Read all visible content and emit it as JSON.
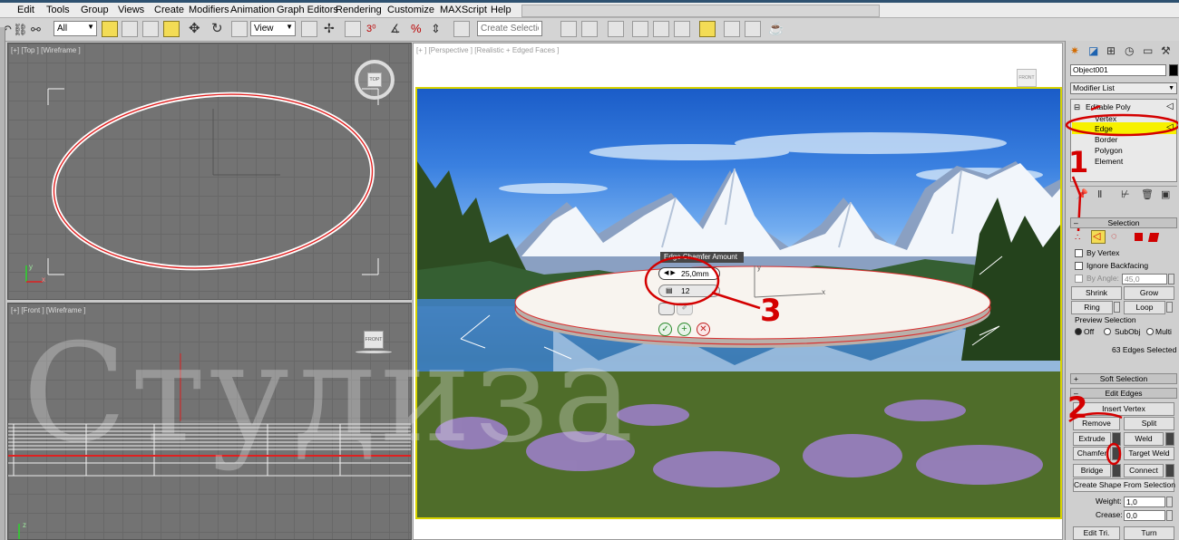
{
  "menu": [
    "Edit",
    "Tools",
    "Group",
    "Views",
    "Create",
    "Modifiers",
    "Animation",
    "Graph Editors",
    "Rendering",
    "Customize",
    "MAXScript",
    "Help"
  ],
  "toolbar": {
    "filter_value": "All",
    "refcoord_value": "View",
    "selection_set_placeholder": "Create Selection Se"
  },
  "viewports": {
    "top_label": "[+] [Top ] [Wireframe ]",
    "front_label": "[+] [Front ] [Wireframe ]",
    "persp_label": "[+ ] [Perspective ] [Realistic + Edged Faces ]",
    "viewcube_top": "TOP",
    "viewcube_front": "FRONT",
    "axis_x": "x",
    "axis_y": "y",
    "axis_z": "z"
  },
  "caddy": {
    "title": "Edge Chamfer Amount",
    "amount": "25,0mm",
    "segments": "12"
  },
  "watermark": "Студиза",
  "annotations": {
    "one": "1",
    "two": "2",
    "three": "3"
  },
  "command_panel": {
    "object_name": "Object001",
    "modifier_list": "Modifier List",
    "stack": {
      "base": "Editable Poly",
      "items": [
        "Vertex",
        "Edge",
        "Border",
        "Polygon",
        "Element"
      ],
      "selected_index": 1
    },
    "selection": {
      "title": "Selection",
      "by_vertex": "By Vertex",
      "ignore_backfacing": "Ignore Backfacing",
      "by_angle": "By Angle:",
      "angle_value": "45,0",
      "shrink": "Shrink",
      "grow": "Grow",
      "ring": "Ring",
      "loop": "Loop",
      "preview_selection": "Preview Selection",
      "off": "Off",
      "subobj": "SubObj",
      "multi": "Multi",
      "status": "63 Edges Selected"
    },
    "soft_selection": "Soft Selection",
    "edit_edges": {
      "title": "Edit Edges",
      "insert_vertex": "Insert Vertex",
      "remove": "Remove",
      "split": "Split",
      "extrude": "Extrude",
      "weld": "Weld",
      "chamfer": "Chamfer",
      "target_weld": "Target Weld",
      "bridge": "Bridge",
      "connect": "Connect",
      "create_shape": "Create Shape From Selection",
      "weight_label": "Weight:",
      "weight_value": "1,0",
      "crease_label": "Crease:",
      "crease_value": "0,0",
      "edit_tri": "Edit Tri.",
      "turn": "Turn"
    }
  },
  "colors": {
    "menubar": "#ececec",
    "viewport_grid": "#737373",
    "highlight": "#f7f100",
    "annotation_red": "#d40000",
    "photo_border": "#d9d400"
  }
}
